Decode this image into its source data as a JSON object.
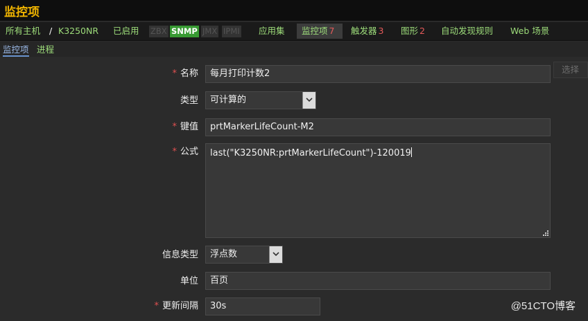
{
  "header": {
    "title": "监控项"
  },
  "breadcrumb": {
    "all_hosts": "所有主机",
    "separator": "/",
    "host": "K3250NR",
    "status": "已启用"
  },
  "availability": [
    "ZBX",
    "SNMP",
    "JMX",
    "IPMI"
  ],
  "nav": {
    "applications": "应用集",
    "items_label": "监控项",
    "items_count": "7",
    "triggers_label": "触发器",
    "triggers_count": "3",
    "graphs_label": "图形",
    "graphs_count": "2",
    "discovery": "自动发现规则",
    "web": "Web 场景"
  },
  "tabs": {
    "item": "监控项",
    "process": "进程"
  },
  "form": {
    "name_label": "名称",
    "name_value": "每月打印计数2",
    "type_label": "类型",
    "type_value": "可计算的",
    "key_label": "键值",
    "key_value": "prtMarkerLifeCount-M2",
    "select_button": "选择",
    "formula_label": "公式",
    "formula_value": "last(\"K3250NR:prtMarkerLifeCount\")-120019",
    "info_type_label": "信息类型",
    "info_type_value": "浮点数",
    "unit_label": "单位",
    "unit_value": "百页",
    "interval_label": "更新间隔",
    "interval_value": "30s",
    "required_marker": "*"
  },
  "watermark": "@51CTO博客",
  "colors": {
    "nav_link": "#9ddc7a",
    "title": "#f0b400",
    "active_tag": "#389a33",
    "count": "#e55a5a",
    "required": "#e05050"
  }
}
